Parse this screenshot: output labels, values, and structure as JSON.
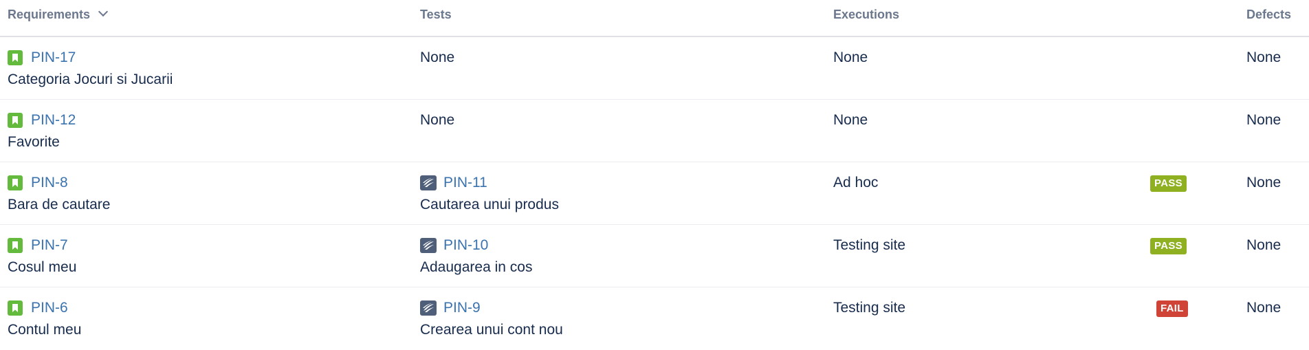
{
  "header": {
    "requirements": "Requirements",
    "tests": "Tests",
    "executions": "Executions",
    "defects": "Defects"
  },
  "colors": {
    "link": "#3b73af",
    "pass": "#8eb021",
    "fail": "#d04437",
    "story_icon": "#63ba3c",
    "test_icon": "#505f79"
  },
  "rows": [
    {
      "req_key": "PIN-17",
      "req_summary": "Categoria Jocuri si Jucarii",
      "tests_text": "None",
      "exec_text": "None",
      "defects": "None"
    },
    {
      "req_key": "PIN-12",
      "req_summary": "Favorite",
      "tests_text": "None",
      "exec_text": "None",
      "defects": "None"
    },
    {
      "req_key": "PIN-8",
      "req_summary": "Bara de cautare",
      "test_key": "PIN-11",
      "test_summary": "Cautarea unui produs",
      "exec_text": "Ad hoc",
      "status": "PASS",
      "defects": "None"
    },
    {
      "req_key": "PIN-7",
      "req_summary": "Cosul meu",
      "test_key": "PIN-10",
      "test_summary": "Adaugarea in cos",
      "exec_text": "Testing site",
      "status": "PASS",
      "defects": "None"
    },
    {
      "req_key": "PIN-6",
      "req_summary": "Contul meu",
      "test_key": "PIN-9",
      "test_summary": "Crearea unui cont nou",
      "exec_text": "Testing site",
      "status": "FAIL",
      "defects": "None"
    }
  ],
  "icons": {
    "requirement": "story-bookmark-icon",
    "test": "test-wing-icon",
    "sort": "chevron-down-icon"
  }
}
